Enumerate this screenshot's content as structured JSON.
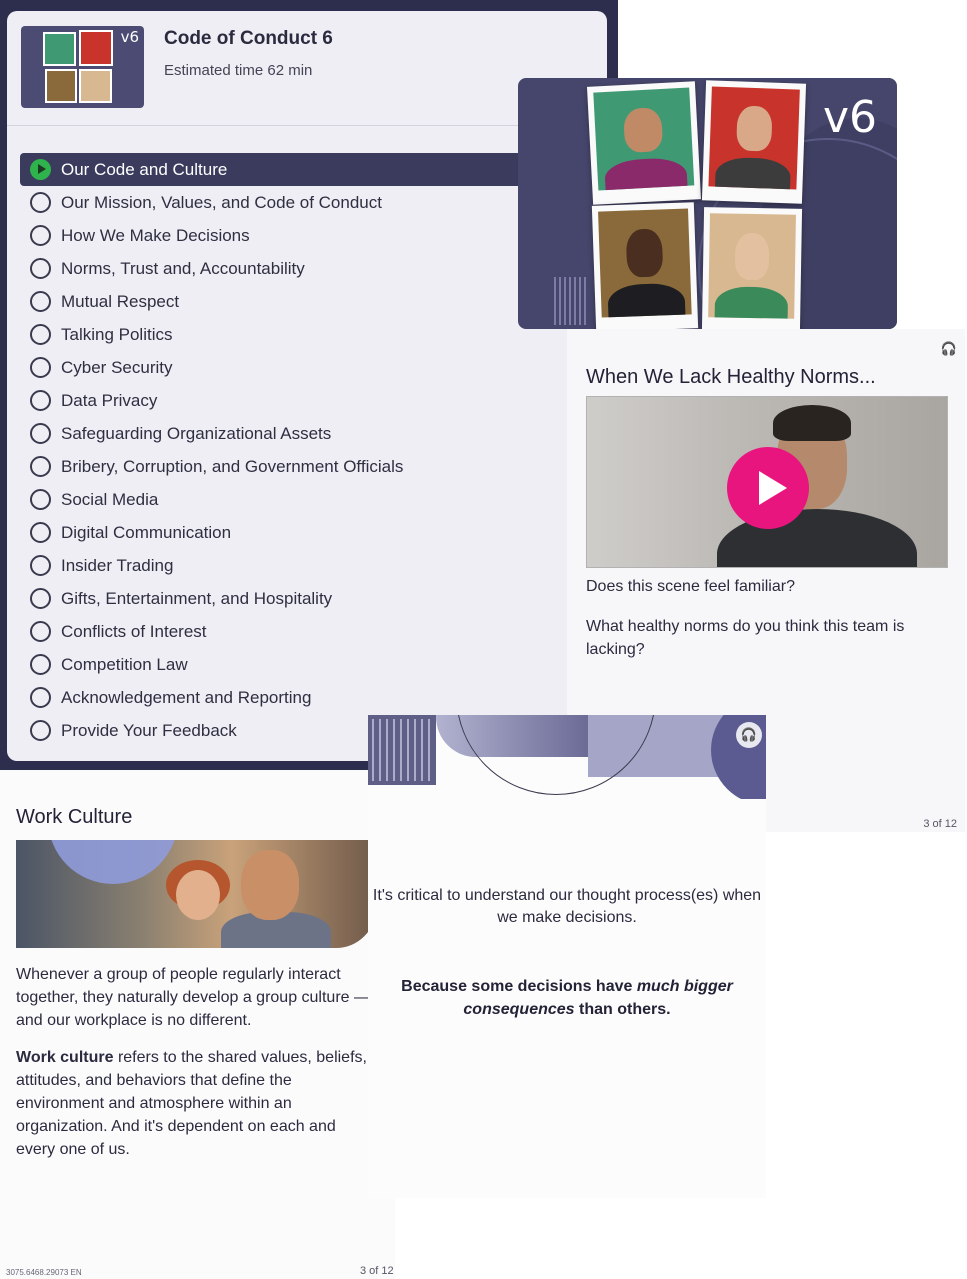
{
  "course": {
    "thumb_label": "v6",
    "title": "Code of Conduct 6",
    "estimated_time": "Estimated time 62 min",
    "topics": [
      {
        "label": "Our Code and Culture",
        "active": true
      },
      {
        "label": "Our Mission, Values, and Code of Conduct",
        "active": false
      },
      {
        "label": "How We Make Decisions",
        "active": false
      },
      {
        "label": "Norms, Trust and, Accountability",
        "active": false
      },
      {
        "label": "Mutual Respect",
        "active": false
      },
      {
        "label": "Talking Politics",
        "active": false
      },
      {
        "label": "Cyber Security",
        "active": false
      },
      {
        "label": "Data Privacy",
        "active": false
      },
      {
        "label": "Safeguarding Organizational Assets",
        "active": false
      },
      {
        "label": "Bribery, Corruption, and Government Officials",
        "active": false
      },
      {
        "label": "Social Media",
        "active": false
      },
      {
        "label": "Digital Communication",
        "active": false
      },
      {
        "label": "Insider Trading",
        "active": false
      },
      {
        "label": "Gifts, Entertainment, and Hospitality",
        "active": false
      },
      {
        "label": "Conflicts of Interest",
        "active": false
      },
      {
        "label": "Competition Law",
        "active": false
      },
      {
        "label": "Acknowledgement and Reporting",
        "active": false
      },
      {
        "label": "Provide Your Feedback",
        "active": false
      }
    ]
  },
  "hero": {
    "label": "v6"
  },
  "norms": {
    "title": "When We Lack Healthy Norms...",
    "question1": "Does this scene feel familiar?",
    "question2": "What healthy norms do you think this team is lacking?",
    "page": "3 of 12",
    "audio_icon": "headphones-icon"
  },
  "culture": {
    "title": "Work Culture",
    "p1": "Whenever a group of people regularly interact together, they naturally develop a group culture — and our workplace is no different.",
    "p2_bold": "Work culture",
    "p2_rest": " refers to the shared values, beliefs, attitudes, and behaviors that define the environment and atmosphere within an organization. And it's dependent on each and every one of us.",
    "doc_id": "3075.6468.29073 EN",
    "page": "3 of 12"
  },
  "decisions": {
    "line1": "It's critical to understand our thought process(es) when we make decisions.",
    "line2_a": "Because some decisions have ",
    "line2_em": "much bigger consequences",
    "line2_b": " than others.",
    "audio_icon": "headphones-icon"
  },
  "colors": {
    "navy": "#2d2d4d",
    "active_row": "#3b3b5e",
    "play_green": "#2fb34c",
    "video_play_pink": "#e8157f"
  }
}
